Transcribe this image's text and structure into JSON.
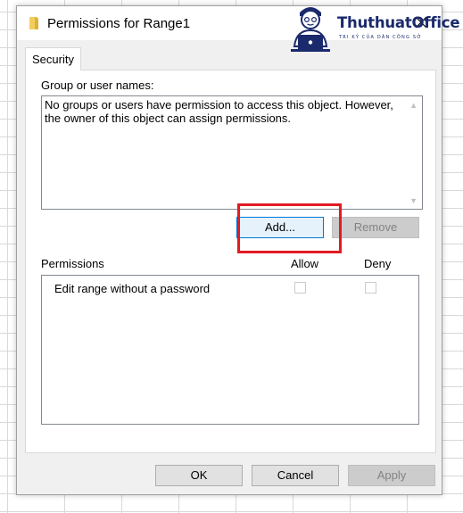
{
  "window": {
    "title": "Permissions for Range1",
    "icon": "folder-icon",
    "close_icon": "close-icon"
  },
  "watermark": {
    "brand": "ThuthuatOffice",
    "tagline": "TRI KỶ CỦA DÂN CÔNG SỞ"
  },
  "tabs": [
    {
      "label": "Security",
      "selected": true
    }
  ],
  "security": {
    "group_label": "Group or user names:",
    "group_message": "No groups or users have permission to access this object. However, the owner of this object can assign permissions.",
    "add_button": "Add...",
    "remove_button": "Remove",
    "permissions_label": "Permissions",
    "allow_header": "Allow",
    "deny_header": "Deny",
    "permissions": [
      {
        "name": "Edit range without a password",
        "allow": false,
        "deny": false
      }
    ]
  },
  "footer": {
    "ok": "OK",
    "cancel": "Cancel",
    "apply": "Apply"
  },
  "colors": {
    "highlight": "#e11b22",
    "focus_border": "#0078d7",
    "dialog_bg": "#f0f0f0"
  }
}
